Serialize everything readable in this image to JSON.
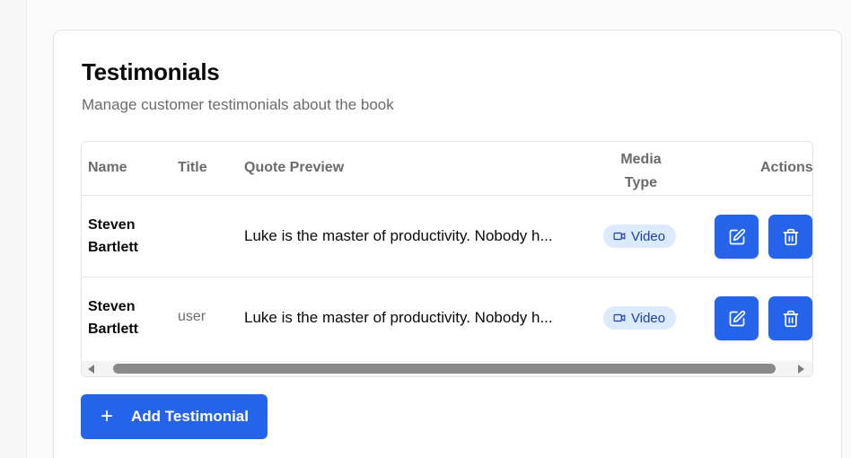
{
  "page": {
    "title": "Testimonials",
    "subtitle": "Manage customer testimonials about the book"
  },
  "table": {
    "columns": [
      "Name",
      "Title",
      "Quote Preview",
      "Media Type",
      "Actions"
    ],
    "media_type_header_line1": "Media",
    "media_type_header_line2": "Type",
    "rows": [
      {
        "name_line1": "Steven",
        "name_line2": "Bartlett",
        "title": "",
        "quote": "Luke is the master of productivity. Nobody h...",
        "media_type": "Video",
        "edit_icon": "edit-icon",
        "delete_icon": "trash-icon"
      },
      {
        "name_line1": "Steven",
        "name_line2": "Bartlett",
        "title": "user",
        "quote": "Luke is the master of productivity. Nobody h...",
        "media_type": "Video",
        "edit_icon": "edit-icon",
        "delete_icon": "trash-icon"
      }
    ]
  },
  "actions": {
    "add_button_icon": "+",
    "add_button_label": "Add Testimonial"
  },
  "colors": {
    "primary": "#2563eb",
    "badge_bg": "#dbeafe",
    "badge_text": "#1e40af"
  }
}
